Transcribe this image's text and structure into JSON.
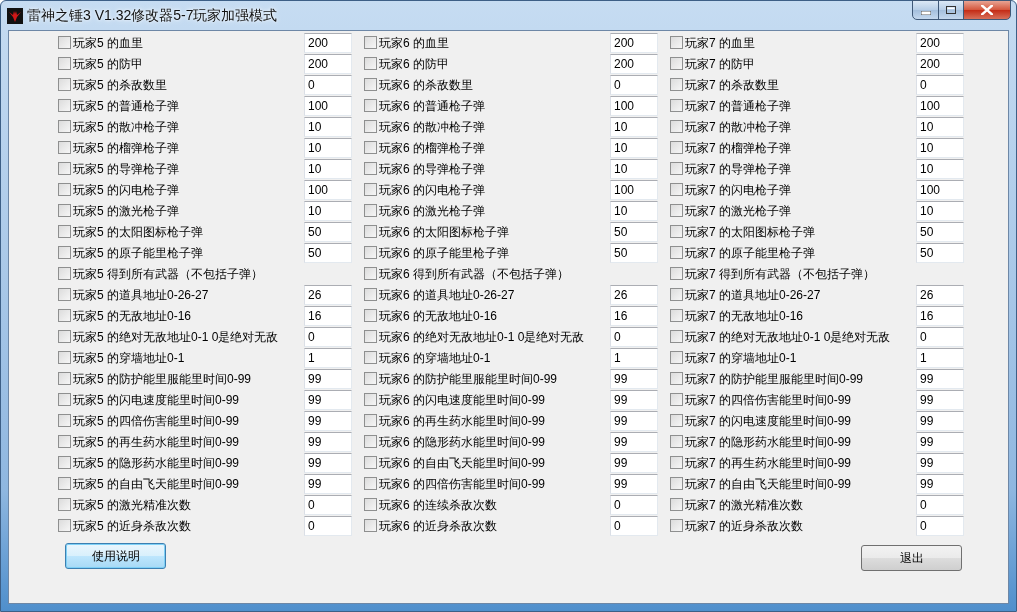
{
  "window": {
    "title": "雷神之锤3 V1.32修改器5-7玩家加强模式"
  },
  "players": [
    {
      "options": [
        {
          "label": "玩家5 的血里",
          "checked": false,
          "value": "200"
        },
        {
          "label": "玩家5 的防甲",
          "checked": false,
          "value": "200"
        },
        {
          "label": "玩家5 的杀敌数里",
          "checked": false,
          "value": "0"
        },
        {
          "label": "玩家5 的普通枪子弹",
          "checked": false,
          "value": "100"
        },
        {
          "label": "玩家5 的散冲枪子弹",
          "checked": false,
          "value": "10"
        },
        {
          "label": "玩家5 的榴弹枪子弹",
          "checked": false,
          "value": "10"
        },
        {
          "label": "玩家5 的导弹枪子弹",
          "checked": false,
          "value": "10"
        },
        {
          "label": "玩家5 的闪电枪子弹",
          "checked": false,
          "value": "100"
        },
        {
          "label": "玩家5 的激光枪子弹",
          "checked": false,
          "value": "10"
        },
        {
          "label": "玩家5 的太阳图标枪子弹",
          "checked": false,
          "value": "50"
        },
        {
          "label": "玩家5 的原子能里枪子弹",
          "checked": false,
          "value": "50"
        },
        {
          "label": "玩家5 得到所有武器（不包括子弹）",
          "checked": false
        },
        {
          "label": "玩家5 的道具地址0-26-27",
          "checked": false,
          "value": "26"
        },
        {
          "label": "玩家5 的无敌地址0-16",
          "checked": false,
          "value": "16"
        },
        {
          "label": "玩家5 的绝对无敌地址0-1 0是绝对无敌",
          "checked": false,
          "value": "0"
        },
        {
          "label": "玩家5 的穿墙地址0-1",
          "checked": false,
          "value": "1"
        },
        {
          "label": "玩家5 的防护能里服能里时间0-99",
          "checked": false,
          "value": "99"
        },
        {
          "label": "玩家5 的闪电速度能里时间0-99",
          "checked": false,
          "value": "99"
        },
        {
          "label": "玩家5 的四倍伤害能里时间0-99",
          "checked": false,
          "value": "99"
        },
        {
          "label": "玩家5 的再生药水能里时间0-99",
          "checked": false,
          "value": "99"
        },
        {
          "label": "玩家5 的隐形药水能里时间0-99",
          "checked": false,
          "value": "99"
        },
        {
          "label": "玩家5 的自由飞天能里时间0-99",
          "checked": false,
          "value": "99"
        },
        {
          "label": "玩家5 的激光精准次数",
          "checked": false,
          "value": "0"
        },
        {
          "label": "玩家5 的近身杀敌次数",
          "checked": false,
          "value": "0"
        }
      ]
    },
    {
      "options": [
        {
          "label": "玩家6 的血里",
          "checked": false,
          "value": "200"
        },
        {
          "label": "玩家6 的防甲",
          "checked": false,
          "value": "200"
        },
        {
          "label": "玩家6 的杀敌数里",
          "checked": false,
          "value": "0"
        },
        {
          "label": "玩家6 的普通枪子弹",
          "checked": false,
          "value": "100"
        },
        {
          "label": "玩家6 的散冲枪子弹",
          "checked": false,
          "value": "10"
        },
        {
          "label": "玩家6 的榴弹枪子弹",
          "checked": false,
          "value": "10"
        },
        {
          "label": "玩家6 的导弹枪子弹",
          "checked": false,
          "value": "10"
        },
        {
          "label": "玩家6 的闪电枪子弹",
          "checked": false,
          "value": "100"
        },
        {
          "label": "玩家6 的激光枪子弹",
          "checked": false,
          "value": "10"
        },
        {
          "label": "玩家6 的太阳图标枪子弹",
          "checked": false,
          "value": "50"
        },
        {
          "label": "玩家6 的原子能里枪子弹",
          "checked": false,
          "value": "50"
        },
        {
          "label": "玩家6 得到所有武器（不包括子弹）",
          "checked": false
        },
        {
          "label": "玩家6 的道具地址0-26-27",
          "checked": false,
          "value": "26"
        },
        {
          "label": "玩家6 的无敌地址0-16",
          "checked": false,
          "value": "16"
        },
        {
          "label": "玩家6 的绝对无敌地址0-1 0是绝对无敌",
          "checked": false,
          "value": "0"
        },
        {
          "label": "玩家6 的穿墙地址0-1",
          "checked": false,
          "value": "1"
        },
        {
          "label": "玩家6 的防护能里服能里时间0-99",
          "checked": false,
          "value": "99"
        },
        {
          "label": "玩家6 的闪电速度能里时间0-99",
          "checked": false,
          "value": "99"
        },
        {
          "label": "玩家6 的再生药水能里时间0-99",
          "checked": false,
          "value": "99"
        },
        {
          "label": "玩家6 的隐形药水能里时间0-99",
          "checked": false,
          "value": "99"
        },
        {
          "label": "玩家6 的自由飞天能里时间0-99",
          "checked": false,
          "value": "99"
        },
        {
          "label": "玩家6 的四倍伤害能里时间0-99",
          "checked": false,
          "value": "99"
        },
        {
          "label": "玩家6 的连续杀敌次数",
          "checked": false,
          "value": "0"
        },
        {
          "label": "玩家6 的近身杀敌次数",
          "checked": false,
          "value": "0"
        }
      ]
    },
    {
      "options": [
        {
          "label": "玩家7 的血里",
          "checked": false,
          "value": "200"
        },
        {
          "label": "玩家7 的防甲",
          "checked": false,
          "value": "200"
        },
        {
          "label": "玩家7 的杀敌数里",
          "checked": false,
          "value": "0"
        },
        {
          "label": "玩家7 的普通枪子弹",
          "checked": false,
          "value": "100"
        },
        {
          "label": "玩家7 的散冲枪子弹",
          "checked": false,
          "value": "10"
        },
        {
          "label": "玩家7 的榴弹枪子弹",
          "checked": false,
          "value": "10"
        },
        {
          "label": "玩家7 的导弹枪子弹",
          "checked": false,
          "value": "10"
        },
        {
          "label": "玩家7 的闪电枪子弹",
          "checked": false,
          "value": "100"
        },
        {
          "label": "玩家7 的激光枪子弹",
          "checked": false,
          "value": "10"
        },
        {
          "label": "玩家7 的太阳图标枪子弹",
          "checked": false,
          "value": "50"
        },
        {
          "label": "玩家7 的原子能里枪子弹",
          "checked": false,
          "value": "50"
        },
        {
          "label": "玩家7 得到所有武器（不包括子弹）",
          "checked": false
        },
        {
          "label": "玩家7 的道具地址0-26-27",
          "checked": false,
          "value": "26"
        },
        {
          "label": "玩家7 的无敌地址0-16",
          "checked": false,
          "value": "16"
        },
        {
          "label": "玩家7 的绝对无敌地址0-1 0是绝对无敌",
          "checked": false,
          "value": "0"
        },
        {
          "label": "玩家7 的穿墙地址0-1",
          "checked": false,
          "value": "1"
        },
        {
          "label": "玩家7 的防护能里服能里时间0-99",
          "checked": false,
          "value": "99"
        },
        {
          "label": "玩家7 的四倍伤害能里时间0-99",
          "checked": false,
          "value": "99"
        },
        {
          "label": "玩家7 的闪电速度能里时间0-99",
          "checked": false,
          "value": "99"
        },
        {
          "label": "玩家7 的隐形药水能里时间0-99",
          "checked": false,
          "value": "99"
        },
        {
          "label": "玩家7 的再生药水能里时间0-99",
          "checked": false,
          "value": "99"
        },
        {
          "label": "玩家7 的自由飞天能里时间0-99",
          "checked": false,
          "value": "99"
        },
        {
          "label": "玩家7 的激光精准次数",
          "checked": false,
          "value": "0"
        },
        {
          "label": "玩家7 的近身杀敌次数",
          "checked": false,
          "value": "0"
        }
      ]
    }
  ],
  "buttons": [
    {
      "label": "使用说明",
      "focused": true
    },
    {
      "label": "退出",
      "focused": false
    }
  ]
}
